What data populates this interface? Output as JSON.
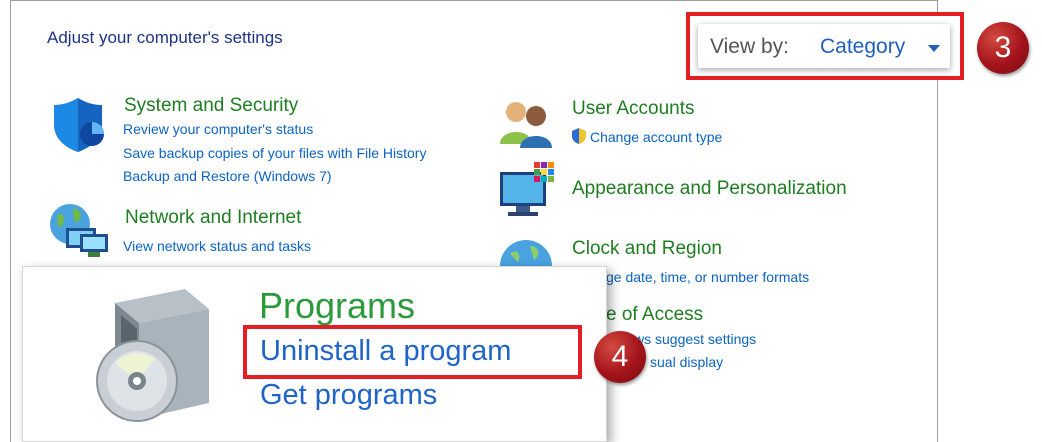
{
  "page_title": "Adjust your computer's settings",
  "view_by": {
    "label": "View by:",
    "value": "Category"
  },
  "categories": {
    "system_security": {
      "title": "System and Security",
      "links": [
        "Review your computer's status",
        "Save backup copies of your files with File History",
        "Backup and Restore (Windows 7)"
      ]
    },
    "network": {
      "title": "Network and Internet",
      "links": [
        "View network status and tasks"
      ]
    },
    "user_accounts": {
      "title": "User Accounts",
      "links": [
        "Change account type"
      ]
    },
    "appearance": {
      "title": "Appearance and Personalization"
    },
    "clock": {
      "title": "Clock and Region",
      "links": [
        "ge date, time, or number formats"
      ]
    },
    "ease": {
      "title": "e of Access",
      "links": [
        "ws suggest settings",
        "sual display"
      ]
    }
  },
  "zoom": {
    "title": "Programs",
    "links": [
      "Uninstall a program",
      "Get programs"
    ]
  },
  "badges": {
    "step3": "3",
    "step4": "4"
  },
  "colors": {
    "link": "#0b63c4",
    "category": "#1e7e21",
    "highlight": "#e31e24",
    "badge": "#a3131b"
  }
}
